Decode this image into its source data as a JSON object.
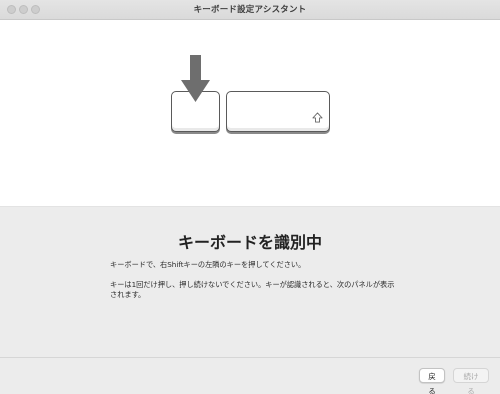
{
  "window": {
    "title": "キーボード設定アシスタント"
  },
  "main": {
    "heading": "キーボードを識別中",
    "instruction": "キーボードで、右Shiftキーの左隣のキーを押してください。",
    "note": "キーは1回だけ押し、押し続けないでください。キーが認識されると、次のパネルが表示されます。"
  },
  "buttons": {
    "back": "戻る",
    "continue": "続ける"
  },
  "icons": {
    "arrow": "down-arrow-icon",
    "shift": "shift-icon"
  },
  "colors": {
    "arrow": "#6e6e6e",
    "key_border": "#5a5a5a",
    "disabled_text": "#aaaaaa"
  }
}
